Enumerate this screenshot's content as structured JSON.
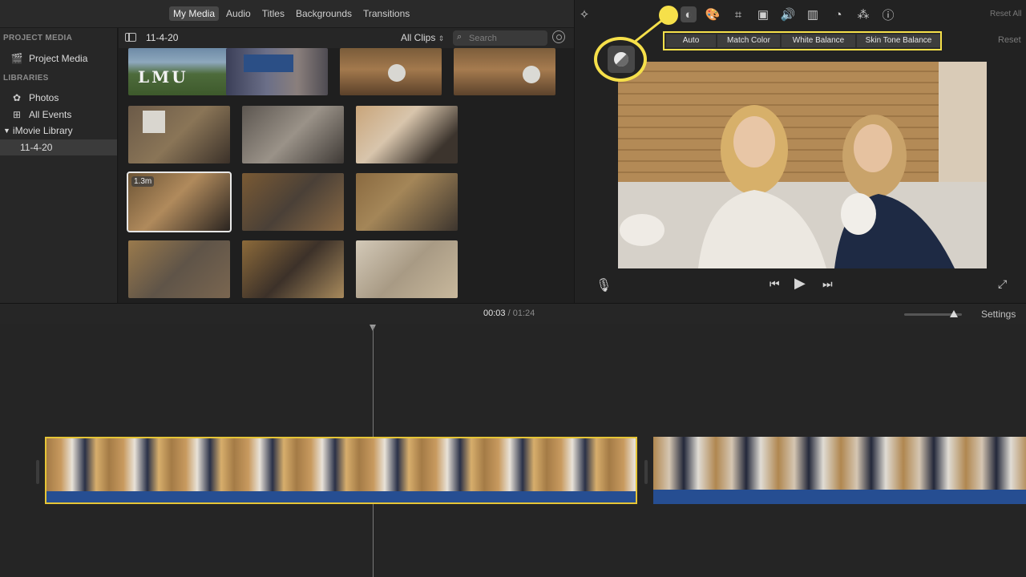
{
  "media_tabs": [
    "My Media",
    "Audio",
    "Titles",
    "Backgrounds",
    "Transitions"
  ],
  "sidebar": {
    "project_heading": "PROJECT MEDIA",
    "project_item": "Project Media",
    "libraries_heading": "LIBRARIES",
    "items": [
      "Photos",
      "All Events"
    ],
    "library_name": "iMovie Library",
    "event_name": "11-4-20"
  },
  "browser": {
    "event_title": "11-4-20",
    "clips_filter": "All Clips",
    "search_placeholder": "Search",
    "selected_clip_duration": "1.3m"
  },
  "viewer": {
    "reset_all": "Reset All",
    "reset": "Reset",
    "color_buttons": [
      "Auto",
      "Match Color",
      "White Balance",
      "Skin Tone Balance"
    ]
  },
  "timeline": {
    "current_time": "00:03",
    "separator": "/",
    "total_time": "01:24",
    "settings": "Settings"
  },
  "colors": {
    "highlight": "#f6e04a",
    "audio": "#264e92",
    "selection": "#e6c536"
  },
  "icons": [
    "magic-wand-icon",
    "color-balance-icon",
    "color-correction-icon",
    "crop-icon",
    "stabilization-icon",
    "volume-icon",
    "noise-reduction-icon",
    "speed-icon",
    "clip-filter-icon",
    "info-icon",
    "microphone-icon",
    "skip-back-icon",
    "play-icon",
    "skip-forward-icon",
    "fullscreen-icon"
  ]
}
